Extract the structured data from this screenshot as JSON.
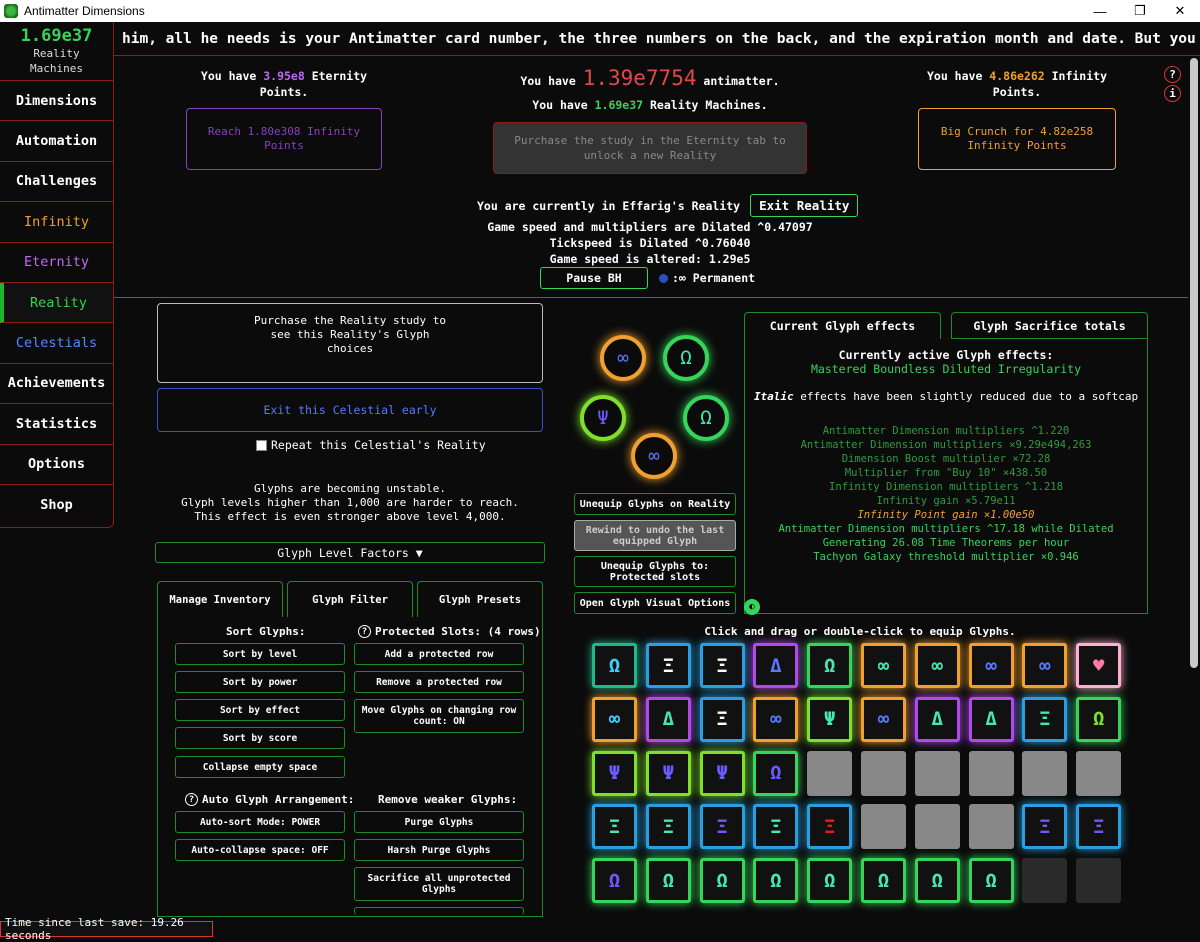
{
  "window": {
    "title": "Antimatter Dimensions",
    "min": "—",
    "max": "❐",
    "close": "✕"
  },
  "sidebar": {
    "rm_value": "1.69e37",
    "rm_label1": "Reality",
    "rm_label2": "Machines",
    "tabs": [
      "Dimensions",
      "Automation",
      "Challenges",
      "Infinity",
      "Eternity",
      "Reality",
      "Celestials",
      "Achievements",
      "Statistics",
      "Options",
      "Shop"
    ]
  },
  "news": "him, all he needs is your Antimatter card number, the three numbers on the back, and the expiration month and date. But you gotta be qu",
  "header": {
    "ep_pre": "You have ",
    "ep_val": "3.95e8",
    "ep_post": " Eternity",
    "ep_post2": "Points.",
    "am_pre": "You have ",
    "am_val": "1.39e7754",
    "am_post": " antimatter.",
    "rm_pre": "You have ",
    "rm_val": "1.69e37",
    "rm_post": " Reality Machines.",
    "ip_pre": "You have ",
    "ip_val": "4.86e262",
    "ip_post": " Infinity",
    "ip_post2": "Points.",
    "reach": "Reach 1.80e308 Infinity Points",
    "study": "Purchase the study in the Eternity tab to unlock a new Reality",
    "crunch": "Big Crunch for 4.82e258 Infinity Points",
    "help": "?",
    "info": "i"
  },
  "reality": {
    "current": "You are currently in Effarig's Reality",
    "exit": "Exit Reality",
    "dilated": "Game speed and multipliers are Dilated ^0.47097",
    "tickspeed": "Tickspeed is Dilated ^0.76040",
    "altered": "Game speed is altered: 1.29e5",
    "pause": "Pause BH",
    "permanent": ":∞ Permanent"
  },
  "left": {
    "study_note": "Purchase the Reality study to see this Reality's Glyph choices",
    "exit_celestial": "Exit this Celestial early",
    "repeat": "Repeat this Celestial's Reality",
    "unstable1": "Glyphs are becoming unstable.",
    "unstable2": "Glyph levels higher than 1,000 are harder to reach.",
    "unstable3": "This effect is even stronger above level 4,000.",
    "glyph_level_factors": "Glyph Level Factors ▼"
  },
  "inventory": {
    "tabs": [
      "Manage Inventory",
      "Glyph Filter",
      "Glyph Presets"
    ],
    "sort_hdr": "Sort Glyphs:",
    "protected_hdr": "Protected Slots: (4 rows)",
    "sort_level": "Sort by level",
    "sort_power": "Sort by power",
    "sort_effect": "Sort by effect",
    "sort_score": "Sort by score",
    "collapse": "Collapse empty space",
    "add_row": "Add a protected row",
    "remove_row": "Remove a protected row",
    "move_glyphs": "Move Glyphs on changing row count: ON",
    "auto_hdr": "Auto Glyph Arrangement:",
    "remove_hdr": "Remove weaker Glyphs:",
    "autosort": "Auto-sort Mode: POWER",
    "autocollapse": "Auto-collapse space: OFF",
    "purge": "Purge Glyphs",
    "harsh": "Harsh Purge Glyphs",
    "sacrifice": "Sacrifice all unprotected Glyphs"
  },
  "equipped": {
    "glyphs": [
      {
        "sym": "∞",
        "color": "#f0a030",
        "inner": "#5a78ff"
      },
      {
        "sym": "Ω",
        "color": "#36d45a",
        "inner": "#46e8b0"
      },
      {
        "sym": "Ψ",
        "color": "#7ee02a",
        "inner": "#6a5aff"
      },
      {
        "sym": "Ω",
        "color": "#36d45a",
        "inner": "#46e8b0"
      },
      {
        "sym": "∞",
        "color": "#f0a030",
        "inner": "#5a78ff"
      }
    ],
    "unequip": "Unequip Glyphs on Reality",
    "rewind": "Rewind to undo the last equipped Glyph",
    "unequip_to": "Unequip Glyphs to: Protected slots",
    "visual": "Open Glyph Visual Options"
  },
  "effects": {
    "tabs": [
      "Current Glyph effects",
      "Glyph Sacrifice totals"
    ],
    "title": "Currently active Glyph effects:",
    "subtitle": "Mastered Boundless Diluted Irregularity",
    "note_italic": "Italic",
    "note_rest": " effects have been slightly reduced due to a softcap",
    "list": [
      "Antimatter Dimension multipliers ^1.220",
      "Antimatter Dimension multipliers ×9.29e494,263",
      "Dimension Boost multiplier ×72.28",
      "Multiplier from \"Buy 10\" ×438.50",
      "Infinity Dimension multipliers ^1.218",
      "Infinity gain ×5.79e11",
      "Infinity Point gain ×1.00e50",
      "Antimatter Dimension multipliers ^17.18 while Dilated",
      "Generating 26.08 Time Theorems per hour",
      "Tachyon Galaxy threshold multiplier ×0.946"
    ]
  },
  "inventory_grid": {
    "hint": "Click and drag or double-click to equip Glyphs.",
    "cells": [
      {
        "t": "g",
        "s": "Ω",
        "c": "#1fb88a",
        "i": "#40d0ff"
      },
      {
        "t": "g",
        "s": "Ξ",
        "c": "#2a9fe0",
        "i": "#ffffff"
      },
      {
        "t": "g",
        "s": "Ξ",
        "c": "#2a9fe0",
        "i": "#ffffff"
      },
      {
        "t": "g",
        "s": "Δ",
        "c": "#b04ae8",
        "i": "#5a78ff"
      },
      {
        "t": "g",
        "s": "Ω",
        "c": "#36d45a",
        "i": "#46e8b0"
      },
      {
        "t": "g",
        "s": "∞",
        "c": "#f0a030",
        "i": "#46e8b0"
      },
      {
        "t": "g",
        "s": "∞",
        "c": "#f0a030",
        "i": "#46e8b0"
      },
      {
        "t": "g",
        "s": "∞",
        "c": "#f0a030",
        "i": "#5a78ff"
      },
      {
        "t": "g",
        "s": "∞",
        "c": "#f0a030",
        "i": "#5a78ff"
      },
      {
        "t": "g",
        "s": "♥",
        "c": "#ffb0d0",
        "i": "#ff7aa8"
      },
      {
        "t": "g",
        "s": "∞",
        "c": "#f0a030",
        "i": "#40d0ff"
      },
      {
        "t": "g",
        "s": "Δ",
        "c": "#b04ae8",
        "i": "#46e8b0"
      },
      {
        "t": "g",
        "s": "Ξ",
        "c": "#2a9fe0",
        "i": "#ffffff"
      },
      {
        "t": "g",
        "s": "∞",
        "c": "#f0a030",
        "i": "#5a78ff"
      },
      {
        "t": "g",
        "s": "Ψ",
        "c": "#7ee02a",
        "i": "#46e8b0"
      },
      {
        "t": "g",
        "s": "∞",
        "c": "#f0a030",
        "i": "#5a78ff"
      },
      {
        "t": "g",
        "s": "Δ",
        "c": "#b04ae8",
        "i": "#46e8b0"
      },
      {
        "t": "g",
        "s": "Δ",
        "c": "#b04ae8",
        "i": "#46e8b0"
      },
      {
        "t": "g",
        "s": "Ξ",
        "c": "#2a9fe0",
        "i": "#46e8b0"
      },
      {
        "t": "g",
        "s": "Ω",
        "c": "#36d45a",
        "i": "#7ee02a"
      },
      {
        "t": "g",
        "s": "Ψ",
        "c": "#7ee02a",
        "i": "#6a5aff"
      },
      {
        "t": "g",
        "s": "Ψ",
        "c": "#7ee02a",
        "i": "#6a5aff"
      },
      {
        "t": "g",
        "s": "Ψ",
        "c": "#7ee02a",
        "i": "#6a5aff"
      },
      {
        "t": "g",
        "s": "Ω",
        "c": "#36d45a",
        "i": "#6a5aff"
      },
      {
        "t": "e"
      },
      {
        "t": "e"
      },
      {
        "t": "e"
      },
      {
        "t": "e"
      },
      {
        "t": "e"
      },
      {
        "t": "e"
      },
      {
        "t": "g",
        "s": "Ξ",
        "c": "#2a9fe0",
        "i": "#46e8b0"
      },
      {
        "t": "g",
        "s": "Ξ",
        "c": "#2a9fe0",
        "i": "#46e8b0"
      },
      {
        "t": "g",
        "s": "Ξ",
        "c": "#2a9fe0",
        "i": "#6a5aff"
      },
      {
        "t": "g",
        "s": "Ξ",
        "c": "#2a9fe0",
        "i": "#46e8b0"
      },
      {
        "t": "g",
        "s": "Ξ",
        "c": "#2a9fe0",
        "i": "#e02020"
      },
      {
        "t": "e"
      },
      {
        "t": "e"
      },
      {
        "t": "e"
      },
      {
        "t": "g",
        "s": "Ξ",
        "c": "#2a9fe0",
        "i": "#6a5aff"
      },
      {
        "t": "g",
        "s": "Ξ",
        "c": "#2a9fe0",
        "i": "#6a5aff"
      },
      {
        "t": "g",
        "s": "Ω",
        "c": "#36d45a",
        "i": "#6a5aff"
      },
      {
        "t": "g",
        "s": "Ω",
        "c": "#36d45a",
        "i": "#46e8b0"
      },
      {
        "t": "g",
        "s": "Ω",
        "c": "#36d45a",
        "i": "#46e8b0"
      },
      {
        "t": "g",
        "s": "Ω",
        "c": "#36d45a",
        "i": "#46e8b0"
      },
      {
        "t": "g",
        "s": "Ω",
        "c": "#36d45a",
        "i": "#46e8b0"
      },
      {
        "t": "g",
        "s": "Ω",
        "c": "#36d45a",
        "i": "#46e8b0"
      },
      {
        "t": "g",
        "s": "Ω",
        "c": "#36d45a",
        "i": "#46e8b0"
      },
      {
        "t": "g",
        "s": "Ω",
        "c": "#36d45a",
        "i": "#46e8b0"
      },
      {
        "t": "d"
      },
      {
        "t": "d"
      }
    ]
  },
  "footer": {
    "save": "Time since last save: 19.26 seconds"
  }
}
